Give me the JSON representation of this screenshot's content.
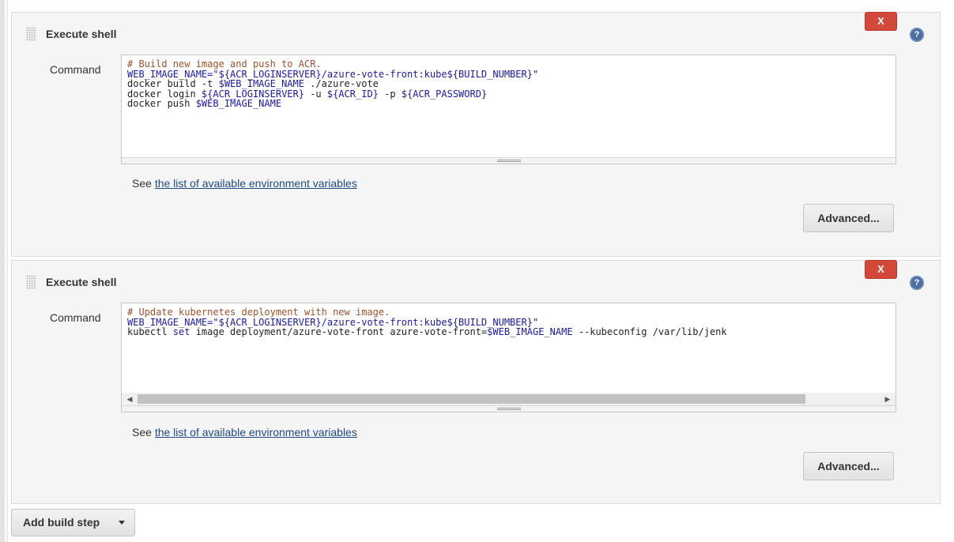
{
  "build_steps": [
    {
      "title": "Execute shell",
      "delete_label": "X",
      "help_label": "?",
      "command_label": "Command",
      "command_lines": [
        [
          {
            "t": "# Build new image and push to ACR.",
            "c": "comment"
          }
        ],
        [
          {
            "t": "WEB_IMAGE_NAME=",
            "c": "blue"
          },
          {
            "t": "\"${ACR_LOGINSERVER}/azure-vote-front:kube${BUILD_NUMBER}\"",
            "c": "blue"
          }
        ],
        [
          {
            "t": "docker build -t ",
            "c": ""
          },
          {
            "t": "$WEB_IMAGE_NAME",
            "c": "blue"
          },
          {
            "t": " ./azure-vote",
            "c": ""
          }
        ],
        [
          {
            "t": "docker login ",
            "c": ""
          },
          {
            "t": "${ACR_LOGINSERVER}",
            "c": "blue"
          },
          {
            "t": " -u ",
            "c": ""
          },
          {
            "t": "${ACR_ID}",
            "c": "blue"
          },
          {
            "t": " -p ",
            "c": ""
          },
          {
            "t": "${ACR_PASSWORD}",
            "c": "blue"
          }
        ],
        [
          {
            "t": "docker push ",
            "c": ""
          },
          {
            "t": "$WEB_IMAGE_NAME",
            "c": "blue"
          }
        ]
      ],
      "see_prefix": "See ",
      "env_link": "the list of available environment variables",
      "advanced_label": "Advanced..."
    },
    {
      "title": "Execute shell",
      "delete_label": "X",
      "help_label": "?",
      "command_label": "Command",
      "command_lines": [
        [
          {
            "t": "# Update kubernetes deployment with new image.",
            "c": "comment"
          }
        ],
        [
          {
            "t": "WEB_IMAGE_NAME=",
            "c": "blue"
          },
          {
            "t": "\"${ACR_LOGINSERVER}/azure-vote-front:kube${BUILD_NUMBER}\"",
            "c": "blue"
          }
        ],
        [
          {
            "t": "kubectl ",
            "c": ""
          },
          {
            "t": "set",
            "c": "blue"
          },
          {
            "t": " image deployment/azure-vote-front azure-vote-front=",
            "c": ""
          },
          {
            "t": "$WEB_IMAGE_NAME",
            "c": "blue"
          },
          {
            "t": " --kubeconfig /var/lib/jenk",
            "c": ""
          }
        ]
      ],
      "see_prefix": "See ",
      "env_link": "the list of available environment variables",
      "advanced_label": "Advanced..."
    }
  ],
  "add_build_step_label": "Add build step",
  "colors": {
    "delete_red": "#d24939",
    "link_blue": "#204a87",
    "help_blue": "#4d6ea3"
  }
}
